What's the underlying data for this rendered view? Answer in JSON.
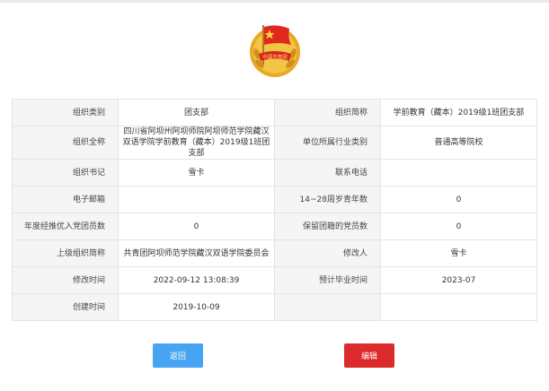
{
  "buttons": {
    "back": "返回",
    "edit": "编辑"
  },
  "emblem": {
    "name": "communist-youth-league-emblem-icon",
    "text": "中国共青团"
  },
  "rows": [
    [
      {
        "label": "组织类别",
        "value": "团支部"
      },
      {
        "label": "组织简称",
        "value": "学前教育（藏本）2019级1班团支部"
      }
    ],
    [
      {
        "label": "组织全称",
        "value": "四川省阿坝州阿坝师院阿坝师范学院藏汉双语学院学前教育（藏本）2019级1班团支部"
      },
      {
        "label": "单位所属行业类别",
        "value": "普通高等院校"
      }
    ],
    [
      {
        "label": "组织书记",
        "value": "雪卡"
      },
      {
        "label": "联系电话",
        "value": ""
      }
    ],
    [
      {
        "label": "电子邮箱",
        "value": ""
      },
      {
        "label": "14~28周岁青年数",
        "value": "0"
      }
    ],
    [
      {
        "label": "年度经推优入党团员数",
        "value": "0"
      },
      {
        "label": "保留团籍的党员数",
        "value": "0"
      }
    ],
    [
      {
        "label": "上级组织简称",
        "value": "共青团阿坝师范学院藏汉双语学院委员会"
      },
      {
        "label": "修改人",
        "value": "雪卡"
      }
    ],
    [
      {
        "label": "修改时间",
        "value": "2022-09-12 13:08:39"
      },
      {
        "label": "预计毕业时间",
        "value": "2023-07"
      }
    ],
    [
      {
        "label": "创建时间",
        "value": "2019-10-09"
      },
      {
        "label": "",
        "value": ""
      }
    ]
  ]
}
